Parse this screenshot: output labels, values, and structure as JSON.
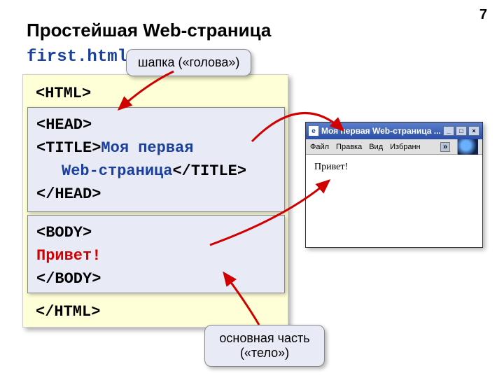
{
  "page_number": "7",
  "slide_title": "Простейшая Web-страница",
  "filename": "first.html",
  "code": {
    "html_open": "<HTML>",
    "head_open": "<HEAD>",
    "title_open": "<TITLE>",
    "title_text_line1": "Моя первая",
    "title_text_line2": "Web-страница",
    "title_close": "</TITLE>",
    "head_close": "</HEAD>",
    "body_open": "<BODY>",
    "body_text": "Привет!",
    "body_close": "</BODY>",
    "html_close": "</HTML>"
  },
  "callouts": {
    "head": "шапка («голова»)",
    "body_line1": "основная часть",
    "body_line2": "(«тело»)"
  },
  "browser": {
    "title": "Моя первая Web-страница ...",
    "menu": {
      "file": "Файл",
      "edit": "Правка",
      "view": "Вид",
      "favorites": "Избранн",
      "more": "»"
    },
    "content": "Привет!"
  }
}
